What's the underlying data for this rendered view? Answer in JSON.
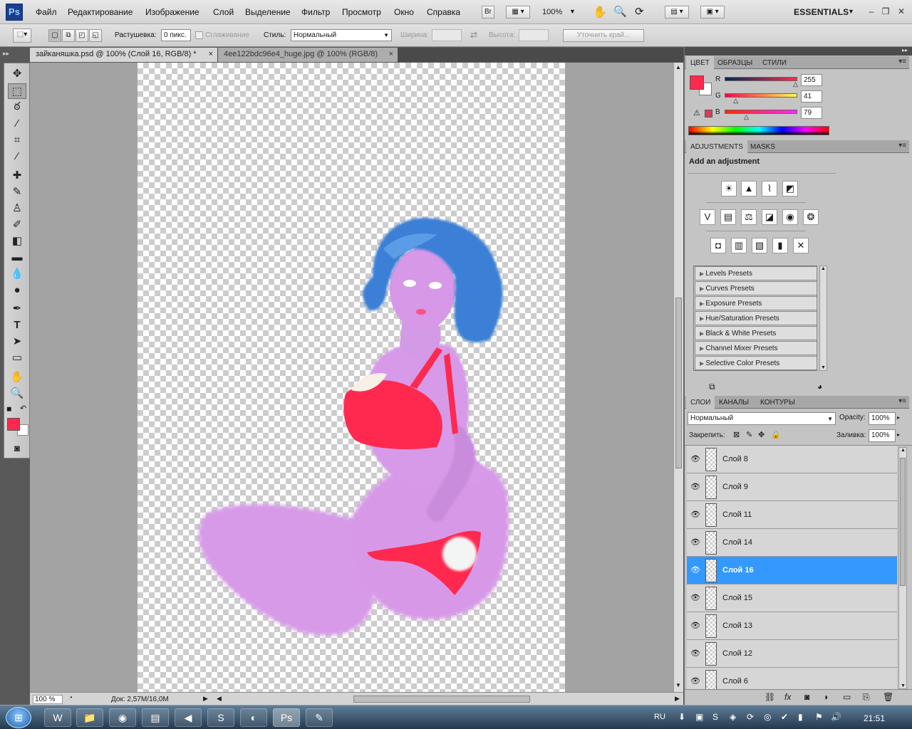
{
  "app": {
    "logo": "Ps"
  },
  "menu": [
    "Файл",
    "Редактирование",
    "Изображение",
    "Слой",
    "Выделение",
    "Фильтр",
    "Просмотр",
    "Окно",
    "Справка"
  ],
  "appbar": {
    "bridge": "Br",
    "zoom": "100%",
    "workspace": "ESSENTIALS"
  },
  "options": {
    "feather_label": "Растушевка:",
    "feather_value": "0 пикс.",
    "antialias_label": "Сглаживание",
    "style_label": "Стиль:",
    "style_value": "Нормальный",
    "width_label": "Ширина:",
    "height_label": "Высота:",
    "refine_button": "Уточнить край..."
  },
  "tabs": [
    {
      "title": "зайканяшка.psd @ 100% (Слой 16, RGB/8) *",
      "close": "×"
    },
    {
      "title": "4ee122bdc96e4_huge.jpg @ 100% (RGB/8)",
      "close": "×"
    }
  ],
  "status": {
    "zoom": "100 %",
    "doc": "Док: 2,57M/16,0M"
  },
  "color_panel": {
    "tabs": [
      "ЦВЕТ",
      "ОБРАЗЦЫ",
      "СТИЛИ"
    ],
    "r_label": "R",
    "r_value": "255",
    "g_label": "G",
    "g_value": "41",
    "b_label": "B",
    "b_value": "79",
    "r": 255,
    "g": 41,
    "b": 79,
    "fg_color": "#ff294f"
  },
  "adjustments": {
    "tabs": [
      "ADJUSTMENTS",
      "MASKS"
    ],
    "heading": "Add an adjustment",
    "presets": [
      "Levels Presets",
      "Curves Presets",
      "Exposure Presets",
      "Hue/Saturation Presets",
      "Black & White Presets",
      "Channel Mixer Presets",
      "Selective Color Presets"
    ]
  },
  "layers_panel": {
    "tabs": [
      "СЛОИ",
      "КАНАЛЫ",
      "КОНТУРЫ"
    ],
    "blend_mode": "Нормальный",
    "opacity_label": "Opacity:",
    "opacity_value": "100%",
    "lock_label": "Закрепить:",
    "fill_label": "Заливка:",
    "fill_value": "100%",
    "layers": [
      "Слой 8",
      "Слой 9",
      "Слой 11",
      "Слой 14",
      "Слой 16",
      "Слой 15",
      "Слой 13",
      "Слой 12",
      "Слой 6"
    ],
    "selected": "Слой 16"
  },
  "taskbar": {
    "lang": "RU",
    "time": "21:51"
  }
}
